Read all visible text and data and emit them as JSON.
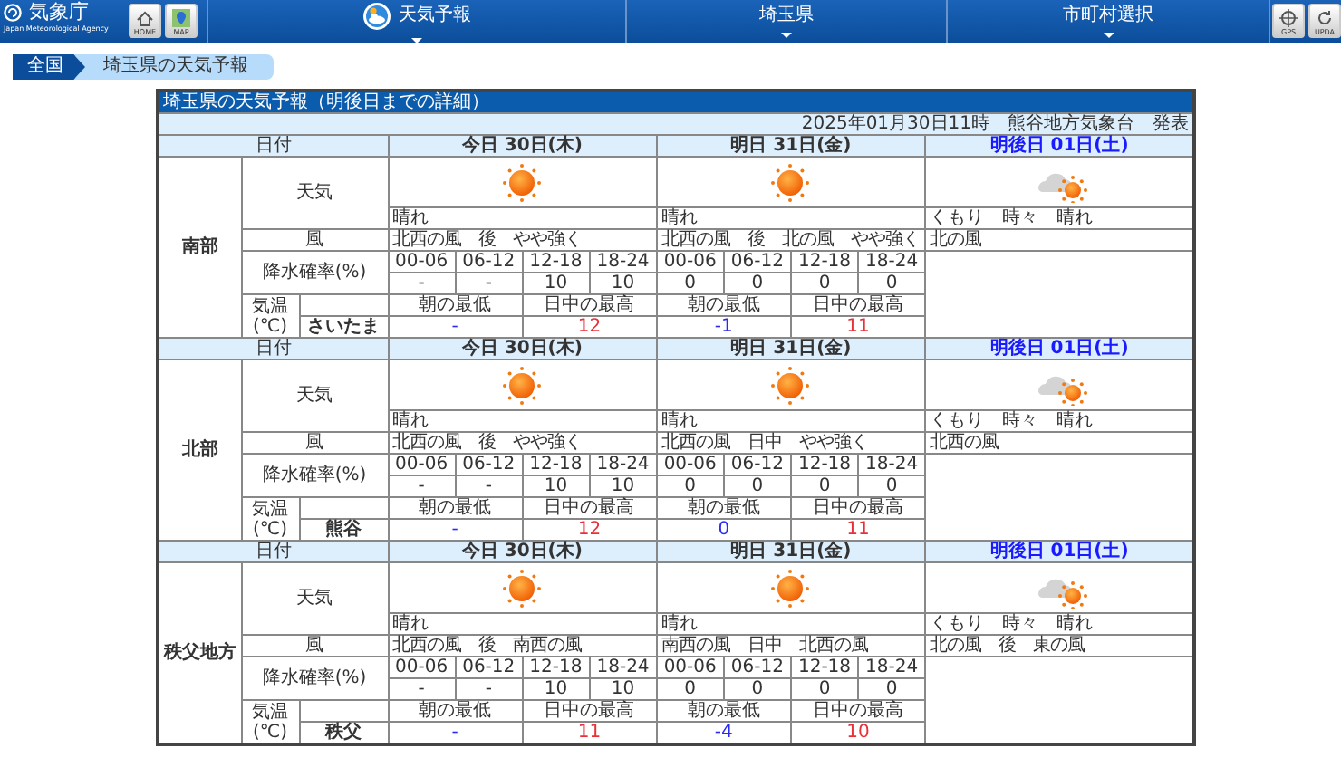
{
  "header": {
    "logo": {
      "title": "気象庁",
      "subtitle": "Japan Meteorological Agency"
    },
    "left_buttons": [
      {
        "label": "HOME",
        "kind": "home"
      },
      {
        "label": "MAP",
        "kind": "map"
      }
    ],
    "menu": [
      {
        "label": "天気予報",
        "kind": "forecast"
      },
      {
        "label": "埼玉県",
        "kind": "dropdown"
      },
      {
        "label": "市町村選択",
        "kind": "dropdown"
      }
    ],
    "right_buttons": [
      {
        "label": "GPS",
        "kind": "gps"
      },
      {
        "label": "UPDA",
        "kind": "update"
      }
    ]
  },
  "breadcrumb": [
    {
      "label": "全国",
      "kind": "link"
    },
    {
      "label": "埼玉県の天気予報",
      "kind": "current"
    }
  ],
  "forecast": {
    "title": "埼玉県の天気予報（明後日までの詳細）",
    "issued": "2025年01月30日11時　熊谷地方気象台　発表",
    "regions": [
      {
        "name": "南部",
        "date_label": "日付",
        "labels": {
          "weather": "天気",
          "wind": "風",
          "precip": "降水確率(%)",
          "temp": "気温",
          "temp_unit": "(℃)"
        },
        "station": "さいたま",
        "days": [
          {
            "date": "今日 30日(木)",
            "kind": "weekday",
            "sky": {
              "kind": "sunny"
            },
            "weather": "晴れ",
            "wind": "北西の風　後　やや強く",
            "precip_times": [
              "00-06",
              "06-12",
              "12-18",
              "18-24"
            ],
            "precip": [
              "-",
              "-",
              "10",
              "10"
            ],
            "temps": [
              {
                "label": "朝の最低",
                "value": "-",
                "kind": "min"
              },
              {
                "label": "日中の最高",
                "value": "12",
                "kind": "max"
              }
            ]
          },
          {
            "date": "明日 31日(金)",
            "kind": "weekday",
            "sky": {
              "kind": "sunny"
            },
            "weather": "晴れ",
            "wind": "北西の風　後　北の風　やや強く",
            "precip_times": [
              "00-06",
              "06-12",
              "12-18",
              "18-24"
            ],
            "precip": [
              "0",
              "0",
              "0",
              "0"
            ],
            "temps": [
              {
                "label": "朝の最低",
                "value": "-1",
                "kind": "min"
              },
              {
                "label": "日中の最高",
                "value": "11",
                "kind": "max"
              }
            ]
          },
          {
            "date": "明後日 01日(土)",
            "kind": "saturday",
            "sky": {
              "kind": "cloudy_sunny"
            },
            "weather": "くもり　時々　晴れ",
            "wind": "北の風"
          }
        ]
      },
      {
        "name": "北部",
        "date_label": "日付",
        "labels": {
          "weather": "天気",
          "wind": "風",
          "precip": "降水確率(%)",
          "temp": "気温",
          "temp_unit": "(℃)"
        },
        "station": "熊谷",
        "days": [
          {
            "date": "今日 30日(木)",
            "kind": "weekday",
            "sky": {
              "kind": "sunny"
            },
            "weather": "晴れ",
            "wind": "北西の風　後　やや強く",
            "precip_times": [
              "00-06",
              "06-12",
              "12-18",
              "18-24"
            ],
            "precip": [
              "-",
              "-",
              "10",
              "10"
            ],
            "temps": [
              {
                "label": "朝の最低",
                "value": "-",
                "kind": "min"
              },
              {
                "label": "日中の最高",
                "value": "12",
                "kind": "max"
              }
            ]
          },
          {
            "date": "明日 31日(金)",
            "kind": "weekday",
            "sky": {
              "kind": "sunny"
            },
            "weather": "晴れ",
            "wind": "北西の風　日中　やや強く",
            "precip_times": [
              "00-06",
              "06-12",
              "12-18",
              "18-24"
            ],
            "precip": [
              "0",
              "0",
              "0",
              "0"
            ],
            "temps": [
              {
                "label": "朝の最低",
                "value": "0",
                "kind": "min"
              },
              {
                "label": "日中の最高",
                "value": "11",
                "kind": "max"
              }
            ]
          },
          {
            "date": "明後日 01日(土)",
            "kind": "saturday",
            "sky": {
              "kind": "cloudy_sunny"
            },
            "weather": "くもり　時々　晴れ",
            "wind": "北西の風"
          }
        ]
      },
      {
        "name": "秩父地方",
        "date_label": "日付",
        "labels": {
          "weather": "天気",
          "wind": "風",
          "precip": "降水確率(%)",
          "temp": "気温",
          "temp_unit": "(℃)"
        },
        "station": "秩父",
        "days": [
          {
            "date": "今日 30日(木)",
            "kind": "weekday",
            "sky": {
              "kind": "sunny"
            },
            "weather": "晴れ",
            "wind": "北西の風　後　南西の風",
            "precip_times": [
              "00-06",
              "06-12",
              "12-18",
              "18-24"
            ],
            "precip": [
              "-",
              "-",
              "10",
              "10"
            ],
            "temps": [
              {
                "label": "朝の最低",
                "value": "-",
                "kind": "min"
              },
              {
                "label": "日中の最高",
                "value": "11",
                "kind": "max"
              }
            ]
          },
          {
            "date": "明日 31日(金)",
            "kind": "weekday",
            "sky": {
              "kind": "sunny"
            },
            "weather": "晴れ",
            "wind": "南西の風　日中　北西の風",
            "precip_times": [
              "00-06",
              "06-12",
              "12-18",
              "18-24"
            ],
            "precip": [
              "0",
              "0",
              "0",
              "0"
            ],
            "temps": [
              {
                "label": "朝の最低",
                "value": "-4",
                "kind": "min"
              },
              {
                "label": "日中の最高",
                "value": "10",
                "kind": "max"
              }
            ]
          },
          {
            "date": "明後日 01日(土)",
            "kind": "saturday",
            "sky": {
              "kind": "cloudy_sunny"
            },
            "weather": "くもり　時々　晴れ",
            "wind": "北の風　後　東の風"
          }
        ]
      }
    ]
  }
}
